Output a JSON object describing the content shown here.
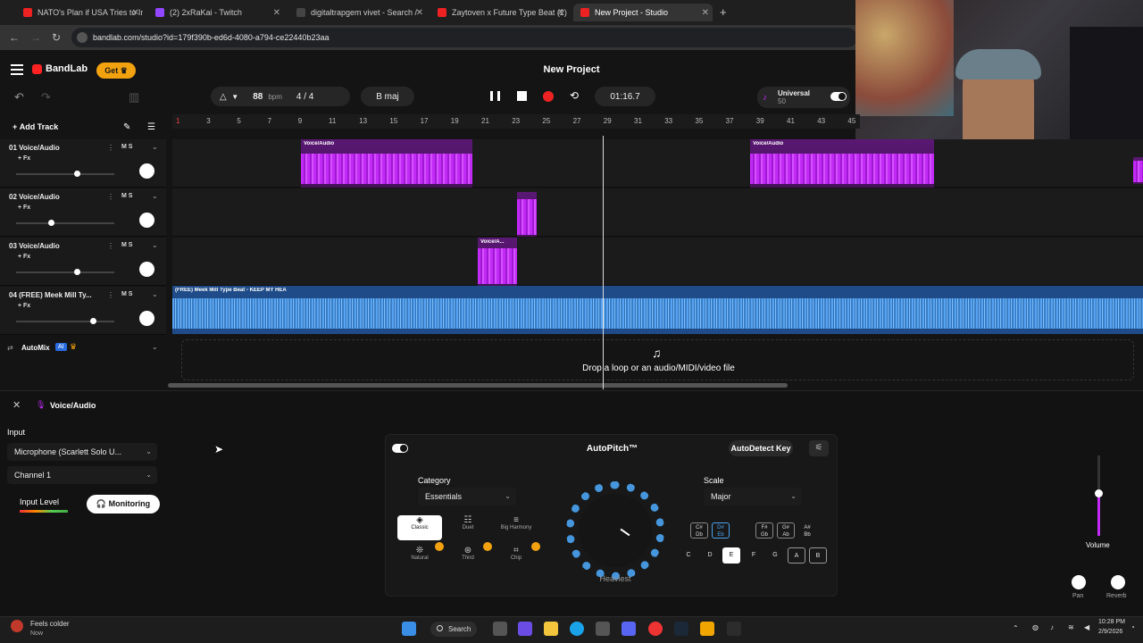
{
  "browser": {
    "tabs": [
      {
        "title": "NATO's Plan if USA Tries to Inv",
        "color": "#e22"
      },
      {
        "title": "(2) 2xRaKai - Twitch",
        "color": "#9146ff"
      },
      {
        "title": "digitaltrapgem vivet - Search /",
        "color": "#333"
      },
      {
        "title": "Zaytoven x Future Type Beat (2)",
        "color": "#e22"
      },
      {
        "title": "New Project - Studio",
        "color": "#e22"
      }
    ],
    "url": "bandlab.com/studio?id=179f390b-ed6d-4080-a794-ce22440b23aa"
  },
  "app": {
    "brand": "BandLab",
    "get_label": "Get",
    "project_title": "New Project",
    "bpm": "88",
    "bpm_unit": "bpm",
    "time_sig": "4 / 4",
    "key": "B maj",
    "time": "01:16.7",
    "preset_name": "Universal",
    "preset_value": "50",
    "add_track": "Add Track"
  },
  "ruler": [
    "1",
    "3",
    "5",
    "7",
    "9",
    "11",
    "13",
    "15",
    "17",
    "19",
    "21",
    "23",
    "25",
    "27",
    "29",
    "31",
    "33",
    "35",
    "37",
    "39",
    "41",
    "43",
    "45"
  ],
  "tracks": [
    {
      "name": "01  Voice/Audio",
      "fx": "+ Fx",
      "ms": "M  S",
      "volume": 0.62
    },
    {
      "name": "02  Voice/Audio",
      "fx": "+ Fx",
      "ms": "M  S",
      "volume": 0.35
    },
    {
      "name": "03  Voice/Audio",
      "fx": "+ Fx",
      "ms": "M  S",
      "volume": 0.62
    },
    {
      "name": "04  (FREE) Meek Mill Ty...",
      "fx": "+ Fx",
      "ms": "M  S",
      "volume": 0.78
    }
  ],
  "regions": {
    "r1": "Voice/Audio",
    "r2": "Voice/Audio",
    "r3": "Voice/A...",
    "beat": "(FREE) Meek Mill Type Beat - KEEP MY HEA"
  },
  "automix": {
    "label": "AutoMix",
    "badge": "AI"
  },
  "drop_text": "Drop a loop or an audio/MIDI/video file",
  "panel": {
    "title": "Voice/Audio",
    "input_label": "Input",
    "input_device": "Microphone (Scarlett Solo U...",
    "channel": "Channel 1",
    "input_level_label": "Input Level",
    "monitoring_label": "Monitoring",
    "volume_label": "Volume",
    "volume_level": 0.53,
    "pan_label": "Pan",
    "reverb_label": "Reverb"
  },
  "autopitch": {
    "title": "AutoPitch™",
    "autodetect": "AutoDetect Key",
    "category_label": "Category",
    "category_value": "Essentials",
    "scale_label": "Scale",
    "scale_value": "Major",
    "dial_label": "Heaviest",
    "modes": [
      "Classic",
      "Duet",
      "Big Harmony",
      "Natural",
      "Third",
      "Chip"
    ],
    "keys": [
      "C",
      "D",
      "E",
      "F",
      "G",
      "A",
      "B"
    ],
    "sharps": [
      {
        "top": "C#",
        "bottom": "Db"
      },
      {
        "top": "D#",
        "bottom": "Eb"
      },
      {
        "top": "F#",
        "bottom": "Gb"
      },
      {
        "top": "G#",
        "bottom": "Ab"
      },
      {
        "top": "A#",
        "bottom": "Bb"
      }
    ]
  },
  "taskbar": {
    "weather": "Feels colder",
    "weather_sub": "Now",
    "search": "Search",
    "time": "10:28 PM",
    "date": "2/9/2026"
  }
}
